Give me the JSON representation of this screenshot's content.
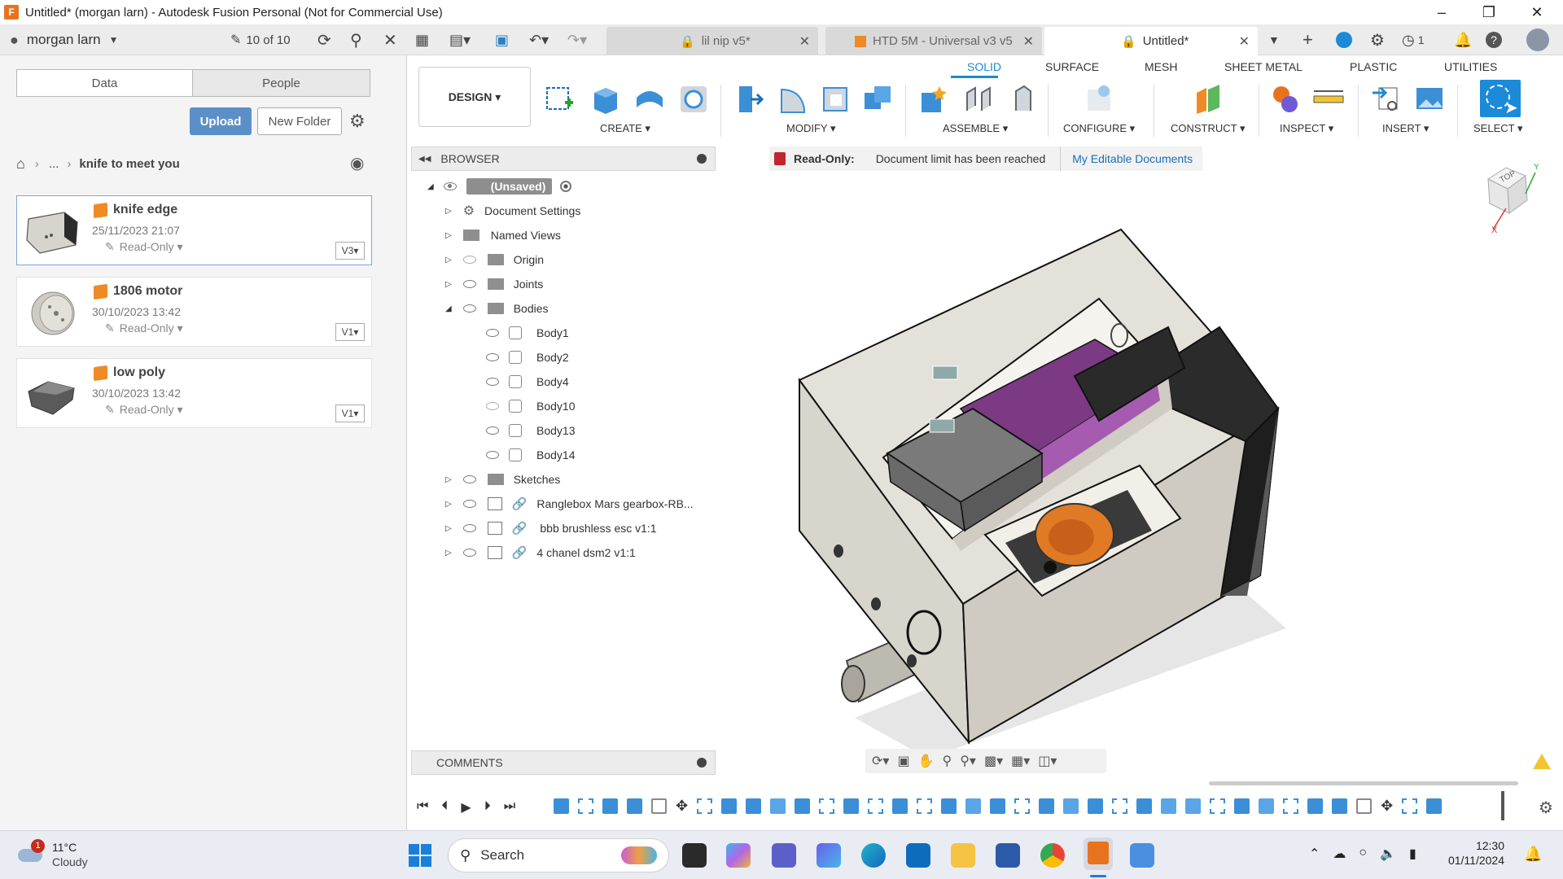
{
  "window": {
    "title": "Untitled* (morgan larn) - Autodesk Fusion Personal (Not for Commercial Use)",
    "app_icon_letter": "F"
  },
  "header": {
    "user": "morgan larn",
    "doc_count": "10 of 10",
    "tabs": [
      {
        "label": "lil nip v5*",
        "active": false
      },
      {
        "label": "HTD 5M - Universal v3 v5",
        "active": false
      },
      {
        "label": "Untitled*",
        "active": true
      }
    ],
    "jobs_count": "1"
  },
  "datapanel": {
    "segments": [
      "Data",
      "People"
    ],
    "upload_label": "Upload",
    "new_folder_label": "New Folder",
    "breadcrumb_ellipsis": "...",
    "breadcrumb_current": "knife to meet you",
    "items": [
      {
        "name": "knife edge",
        "date": "25/11/2023 21:07",
        "access": "Read-Only",
        "version": "V3"
      },
      {
        "name": "1806 motor",
        "date": "30/10/2023 13:42",
        "access": "Read-Only",
        "version": "V1"
      },
      {
        "name": "low poly",
        "date": "30/10/2023 13:42",
        "access": "Read-Only",
        "version": "V1"
      }
    ]
  },
  "toolbar": {
    "design_label": "DESIGN",
    "workspace_tabs": [
      "SOLID",
      "SURFACE",
      "MESH",
      "SHEET METAL",
      "PLASTIC",
      "UTILITIES"
    ],
    "groups": [
      "CREATE",
      "MODIFY",
      "ASSEMBLE",
      "CONFIGURE",
      "CONSTRUCT",
      "INSPECT",
      "INSERT",
      "SELECT"
    ]
  },
  "browser": {
    "title": "BROWSER",
    "root": "(Unsaved)",
    "nodes": {
      "doc_settings": "Document Settings",
      "named_views": "Named Views",
      "origin": "Origin",
      "joints": "Joints",
      "bodies": "Bodies",
      "body1": "Body1",
      "body2": "Body2",
      "body4": "Body4",
      "body10": "Body10",
      "body13": "Body13",
      "body14": "Body14",
      "sketches": "Sketches",
      "link1": "Ranglebox Mars gearbox-RB...",
      "link2": "bbb brushless esc v1:1",
      "link3": "4 chanel dsm2 v1:1"
    },
    "comments": "COMMENTS"
  },
  "banner": {
    "label": "Read-Only:",
    "message": "Document limit has been reached",
    "link": "My Editable Documents"
  },
  "viewcube": {
    "face": "TOP"
  },
  "taskbar": {
    "weather_temp": "11°C",
    "weather_desc": "Cloudy",
    "weather_badge": "1",
    "search_label": "Search",
    "time": "12:30",
    "date": "01/11/2024"
  },
  "colors": {
    "accent": "#1b8ad8",
    "upload": "#5b8fc7",
    "fusion_orange": "#e8731f",
    "readonly_red": "#c0262d"
  }
}
